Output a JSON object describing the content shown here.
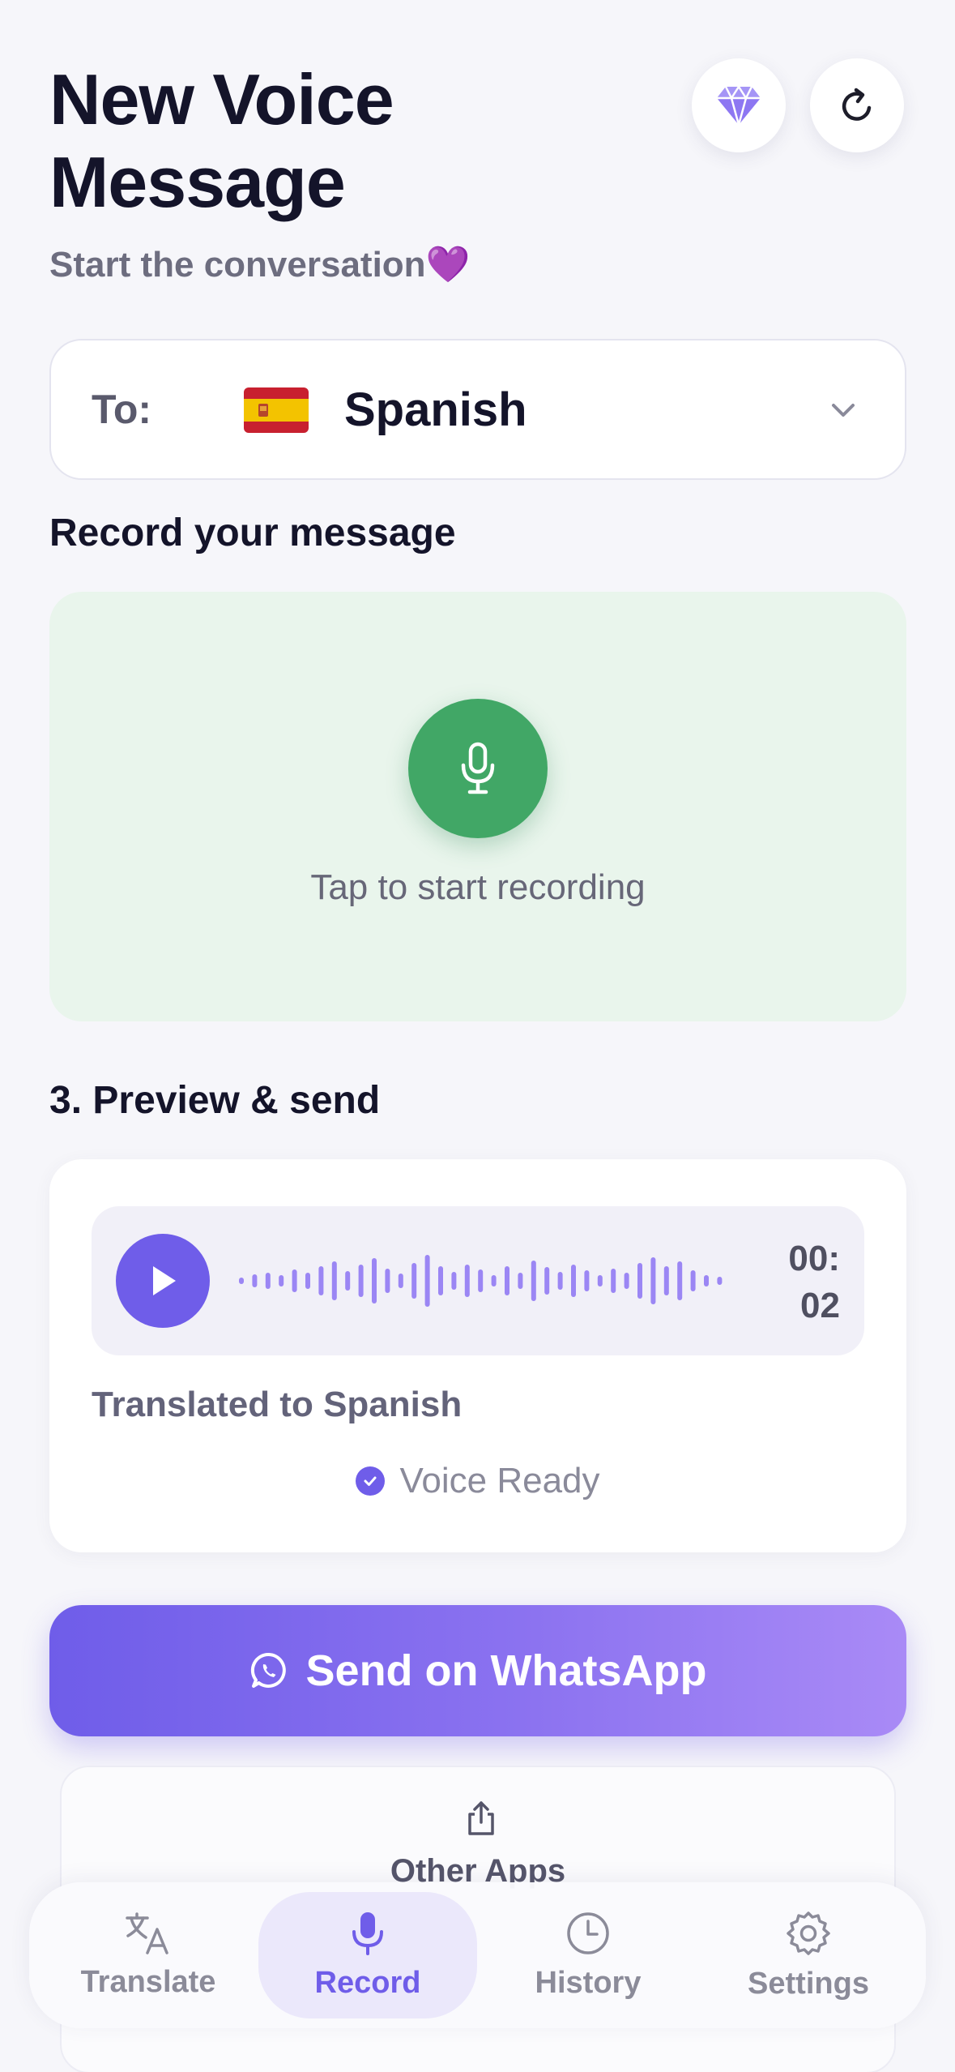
{
  "header": {
    "title": "New Voice Message",
    "subtitle": "Start the conversation",
    "subtitle_emoji": "💜",
    "icons": [
      "gem-icon",
      "refresh-icon"
    ]
  },
  "language": {
    "to_label": "To:",
    "flag": "Spain",
    "name": "Spanish"
  },
  "record": {
    "heading": "Record your message",
    "hint": "Tap to start recording"
  },
  "preview": {
    "heading": "3. Preview & send",
    "duration_line1": "00:",
    "duration_line2": "02",
    "translated_text": "Translated to Spanish",
    "status": "Voice Ready"
  },
  "send": {
    "label": "Send on WhatsApp"
  },
  "other_apps": {
    "label": "Other Apps"
  },
  "tabs": [
    {
      "label": "Translate",
      "icon": "translate-icon",
      "active": false
    },
    {
      "label": "Record",
      "icon": "mic-icon",
      "active": true
    },
    {
      "label": "History",
      "icon": "clock-icon",
      "active": false
    },
    {
      "label": "Settings",
      "icon": "gear-icon",
      "active": false
    }
  ],
  "colors": {
    "accent": "#6f5de9",
    "record_green": "#41a766",
    "record_bg": "#e9f5ec",
    "background": "#f6f6fa"
  }
}
